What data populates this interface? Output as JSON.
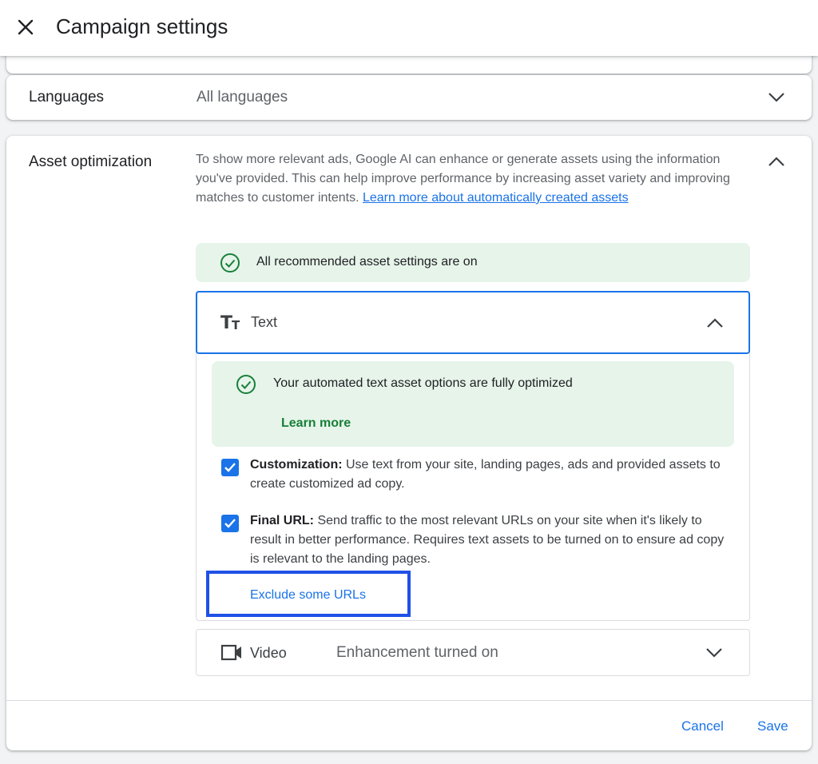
{
  "header": {
    "title": "Campaign settings",
    "close_icon": "close-icon"
  },
  "languages": {
    "label": "Languages",
    "value": "All languages",
    "icon": "chevron-down-icon"
  },
  "asset_optimization": {
    "label": "Asset optimization",
    "description": "To show more relevant ads, Google AI can enhance or generate assets using the information you've provided. This can help improve performance by increasing asset variety and improving matches to customer intents.",
    "learn_more_link": "Learn more about automatically created assets",
    "status_banner": "All recommended asset settings are on",
    "text_section": {
      "title": "Text",
      "icon": "text-fields-icon",
      "optimized_banner": "Your automated text asset options are fully optimized",
      "learn_more": "Learn more",
      "options": [
        {
          "label": "Customization:",
          "description": "Use text from your site, landing pages, ads and provided assets to create customized ad copy.",
          "checked": true
        },
        {
          "label": "Final URL:",
          "description": "Send traffic to the most relevant URLs on your site when it's likely to result in better performance. Requires text assets to be turned on to ensure ad copy is relevant to the landing pages.",
          "checked": true
        }
      ],
      "exclude_link": "Exclude some URLs"
    },
    "video_section": {
      "title": "Video",
      "status": "Enhancement turned on",
      "icon": "video-camera-icon"
    }
  },
  "footer": {
    "cancel": "Cancel",
    "save": "Save"
  },
  "colors": {
    "accent": "#1a73e8",
    "success_bg": "#e6f4ea",
    "success": "#188038",
    "highlight_box": "#1f51e6"
  }
}
